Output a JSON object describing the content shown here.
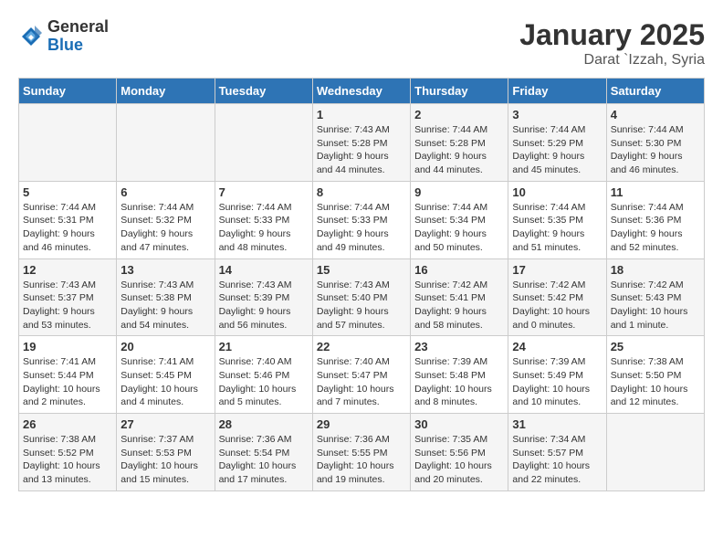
{
  "header": {
    "logo_general": "General",
    "logo_blue": "Blue",
    "title": "January 2025",
    "subtitle": "Darat `Izzah, Syria"
  },
  "days_of_week": [
    "Sunday",
    "Monday",
    "Tuesday",
    "Wednesday",
    "Thursday",
    "Friday",
    "Saturday"
  ],
  "weeks": [
    [
      {
        "day": "",
        "info": ""
      },
      {
        "day": "",
        "info": ""
      },
      {
        "day": "",
        "info": ""
      },
      {
        "day": "1",
        "info": "Sunrise: 7:43 AM\nSunset: 5:28 PM\nDaylight: 9 hours and 44 minutes."
      },
      {
        "day": "2",
        "info": "Sunrise: 7:44 AM\nSunset: 5:28 PM\nDaylight: 9 hours and 44 minutes."
      },
      {
        "day": "3",
        "info": "Sunrise: 7:44 AM\nSunset: 5:29 PM\nDaylight: 9 hours and 45 minutes."
      },
      {
        "day": "4",
        "info": "Sunrise: 7:44 AM\nSunset: 5:30 PM\nDaylight: 9 hours and 46 minutes."
      }
    ],
    [
      {
        "day": "5",
        "info": "Sunrise: 7:44 AM\nSunset: 5:31 PM\nDaylight: 9 hours and 46 minutes."
      },
      {
        "day": "6",
        "info": "Sunrise: 7:44 AM\nSunset: 5:32 PM\nDaylight: 9 hours and 47 minutes."
      },
      {
        "day": "7",
        "info": "Sunrise: 7:44 AM\nSunset: 5:33 PM\nDaylight: 9 hours and 48 minutes."
      },
      {
        "day": "8",
        "info": "Sunrise: 7:44 AM\nSunset: 5:33 PM\nDaylight: 9 hours and 49 minutes."
      },
      {
        "day": "9",
        "info": "Sunrise: 7:44 AM\nSunset: 5:34 PM\nDaylight: 9 hours and 50 minutes."
      },
      {
        "day": "10",
        "info": "Sunrise: 7:44 AM\nSunset: 5:35 PM\nDaylight: 9 hours and 51 minutes."
      },
      {
        "day": "11",
        "info": "Sunrise: 7:44 AM\nSunset: 5:36 PM\nDaylight: 9 hours and 52 minutes."
      }
    ],
    [
      {
        "day": "12",
        "info": "Sunrise: 7:43 AM\nSunset: 5:37 PM\nDaylight: 9 hours and 53 minutes."
      },
      {
        "day": "13",
        "info": "Sunrise: 7:43 AM\nSunset: 5:38 PM\nDaylight: 9 hours and 54 minutes."
      },
      {
        "day": "14",
        "info": "Sunrise: 7:43 AM\nSunset: 5:39 PM\nDaylight: 9 hours and 56 minutes."
      },
      {
        "day": "15",
        "info": "Sunrise: 7:43 AM\nSunset: 5:40 PM\nDaylight: 9 hours and 57 minutes."
      },
      {
        "day": "16",
        "info": "Sunrise: 7:42 AM\nSunset: 5:41 PM\nDaylight: 9 hours and 58 minutes."
      },
      {
        "day": "17",
        "info": "Sunrise: 7:42 AM\nSunset: 5:42 PM\nDaylight: 10 hours and 0 minutes."
      },
      {
        "day": "18",
        "info": "Sunrise: 7:42 AM\nSunset: 5:43 PM\nDaylight: 10 hours and 1 minute."
      }
    ],
    [
      {
        "day": "19",
        "info": "Sunrise: 7:41 AM\nSunset: 5:44 PM\nDaylight: 10 hours and 2 minutes."
      },
      {
        "day": "20",
        "info": "Sunrise: 7:41 AM\nSunset: 5:45 PM\nDaylight: 10 hours and 4 minutes."
      },
      {
        "day": "21",
        "info": "Sunrise: 7:40 AM\nSunset: 5:46 PM\nDaylight: 10 hours and 5 minutes."
      },
      {
        "day": "22",
        "info": "Sunrise: 7:40 AM\nSunset: 5:47 PM\nDaylight: 10 hours and 7 minutes."
      },
      {
        "day": "23",
        "info": "Sunrise: 7:39 AM\nSunset: 5:48 PM\nDaylight: 10 hours and 8 minutes."
      },
      {
        "day": "24",
        "info": "Sunrise: 7:39 AM\nSunset: 5:49 PM\nDaylight: 10 hours and 10 minutes."
      },
      {
        "day": "25",
        "info": "Sunrise: 7:38 AM\nSunset: 5:50 PM\nDaylight: 10 hours and 12 minutes."
      }
    ],
    [
      {
        "day": "26",
        "info": "Sunrise: 7:38 AM\nSunset: 5:52 PM\nDaylight: 10 hours and 13 minutes."
      },
      {
        "day": "27",
        "info": "Sunrise: 7:37 AM\nSunset: 5:53 PM\nDaylight: 10 hours and 15 minutes."
      },
      {
        "day": "28",
        "info": "Sunrise: 7:36 AM\nSunset: 5:54 PM\nDaylight: 10 hours and 17 minutes."
      },
      {
        "day": "29",
        "info": "Sunrise: 7:36 AM\nSunset: 5:55 PM\nDaylight: 10 hours and 19 minutes."
      },
      {
        "day": "30",
        "info": "Sunrise: 7:35 AM\nSunset: 5:56 PM\nDaylight: 10 hours and 20 minutes."
      },
      {
        "day": "31",
        "info": "Sunrise: 7:34 AM\nSunset: 5:57 PM\nDaylight: 10 hours and 22 minutes."
      },
      {
        "day": "",
        "info": ""
      }
    ]
  ]
}
